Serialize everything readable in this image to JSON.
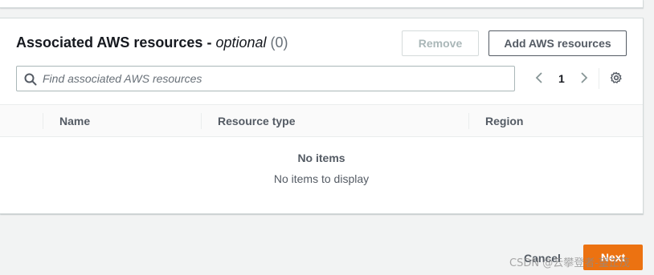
{
  "section": {
    "title": "Associated AWS resources",
    "separator": " - ",
    "optional_label": "optional",
    "count": "(0)",
    "remove_label": "Remove",
    "add_label": "Add AWS resources"
  },
  "search": {
    "placeholder": "Find associated AWS resources",
    "value": ""
  },
  "pagination": {
    "current_page": "1",
    "prev_icon": "chevron-left-icon",
    "next_icon": "chevron-right-icon",
    "settings_icon": "gear-icon"
  },
  "table": {
    "columns": [
      "Name",
      "Resource type",
      "Region"
    ],
    "empty_title": "No items",
    "empty_subtitle": "No items to display"
  },
  "footer": {
    "cancel_label": "Cancel",
    "next_label": "Next",
    "accent_color": "#ec7211"
  },
  "watermark": "CSDN @云攀登者-望正茂"
}
